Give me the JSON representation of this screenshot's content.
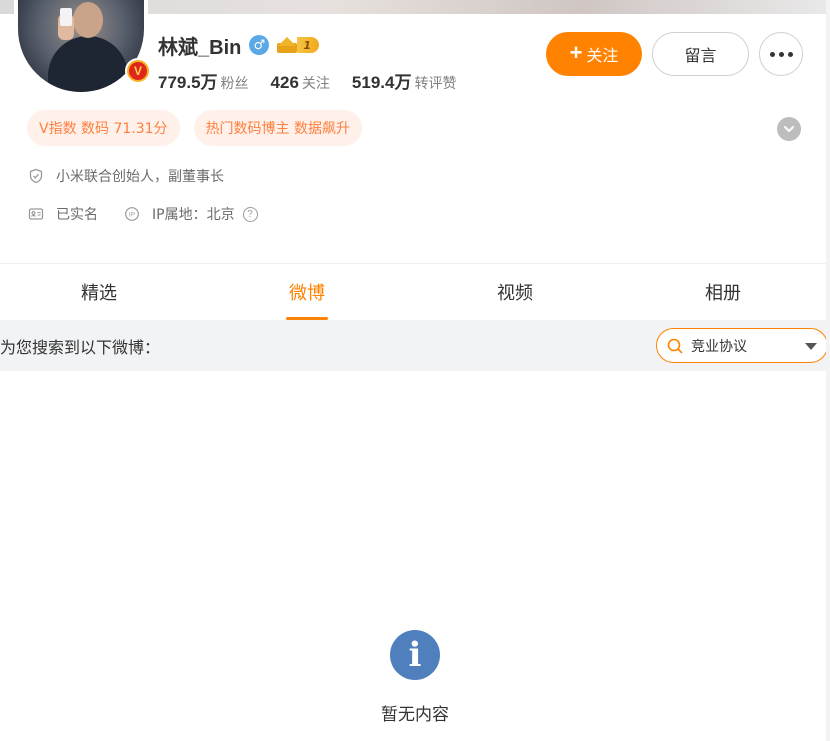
{
  "profile": {
    "name": "林斌_Bin",
    "gender_icon": "♂",
    "level": "1",
    "verified_badge": "V",
    "stats": [
      {
        "num": "779.5万",
        "label": "粉丝"
      },
      {
        "num": "426",
        "label": "关注"
      },
      {
        "num": "519.4万",
        "label": "转评赞"
      }
    ]
  },
  "actions": {
    "follow_plus": "+",
    "follow": "关注",
    "message": "留言"
  },
  "tags": [
    "V指数 数码 71.31分",
    "热门数码博主 数据飙升"
  ],
  "info": {
    "bio": "小米联合创始人，副董事长",
    "verified": "已实名",
    "ip": "IP属地：北京",
    "help": "?"
  },
  "tabs": [
    {
      "label": "精选",
      "active": false
    },
    {
      "label": "微博",
      "active": true
    },
    {
      "label": "视频",
      "active": false
    },
    {
      "label": "相册",
      "active": false
    }
  ],
  "search": {
    "title": "为您搜索到以下微博：",
    "value": "竞业协议"
  },
  "empty": {
    "icon": "i",
    "text": "暂无内容"
  },
  "colors": {
    "accent": "#ff8200",
    "tag_bg": "#fff1ea",
    "tag_text": "#ff7f3f",
    "info_icon": "#4f7fbd"
  }
}
